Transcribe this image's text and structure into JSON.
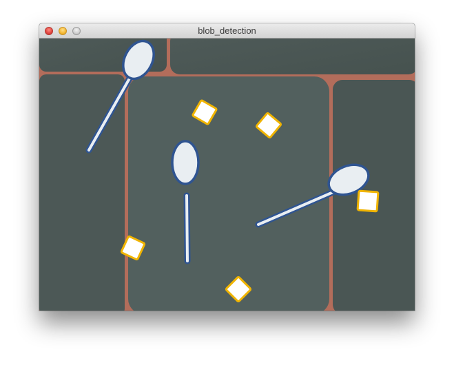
{
  "window": {
    "title": "blob_detection",
    "controls": {
      "close_icon": "close-traffic-light-icon",
      "minimize_icon": "minimize-traffic-light-icon",
      "maximize_icon": "maximize-traffic-light-icon"
    }
  },
  "image": {
    "description_icon": "camera-feed-canvas",
    "colors": {
      "background": "#4a5654",
      "tile_seam": "#b7634f",
      "spoon_fill": "#e9eef2",
      "spoon_outline": "#2f5491",
      "square_fill": "#ffffff",
      "square_outline": "#f0b400"
    },
    "blobs": {
      "spoons": [
        {
          "id": "spoon-1"
        },
        {
          "id": "spoon-2"
        },
        {
          "id": "spoon-3"
        }
      ],
      "squares": [
        {
          "id": "square-1"
        },
        {
          "id": "square-2"
        },
        {
          "id": "square-3"
        },
        {
          "id": "square-4"
        },
        {
          "id": "square-5"
        }
      ]
    }
  }
}
